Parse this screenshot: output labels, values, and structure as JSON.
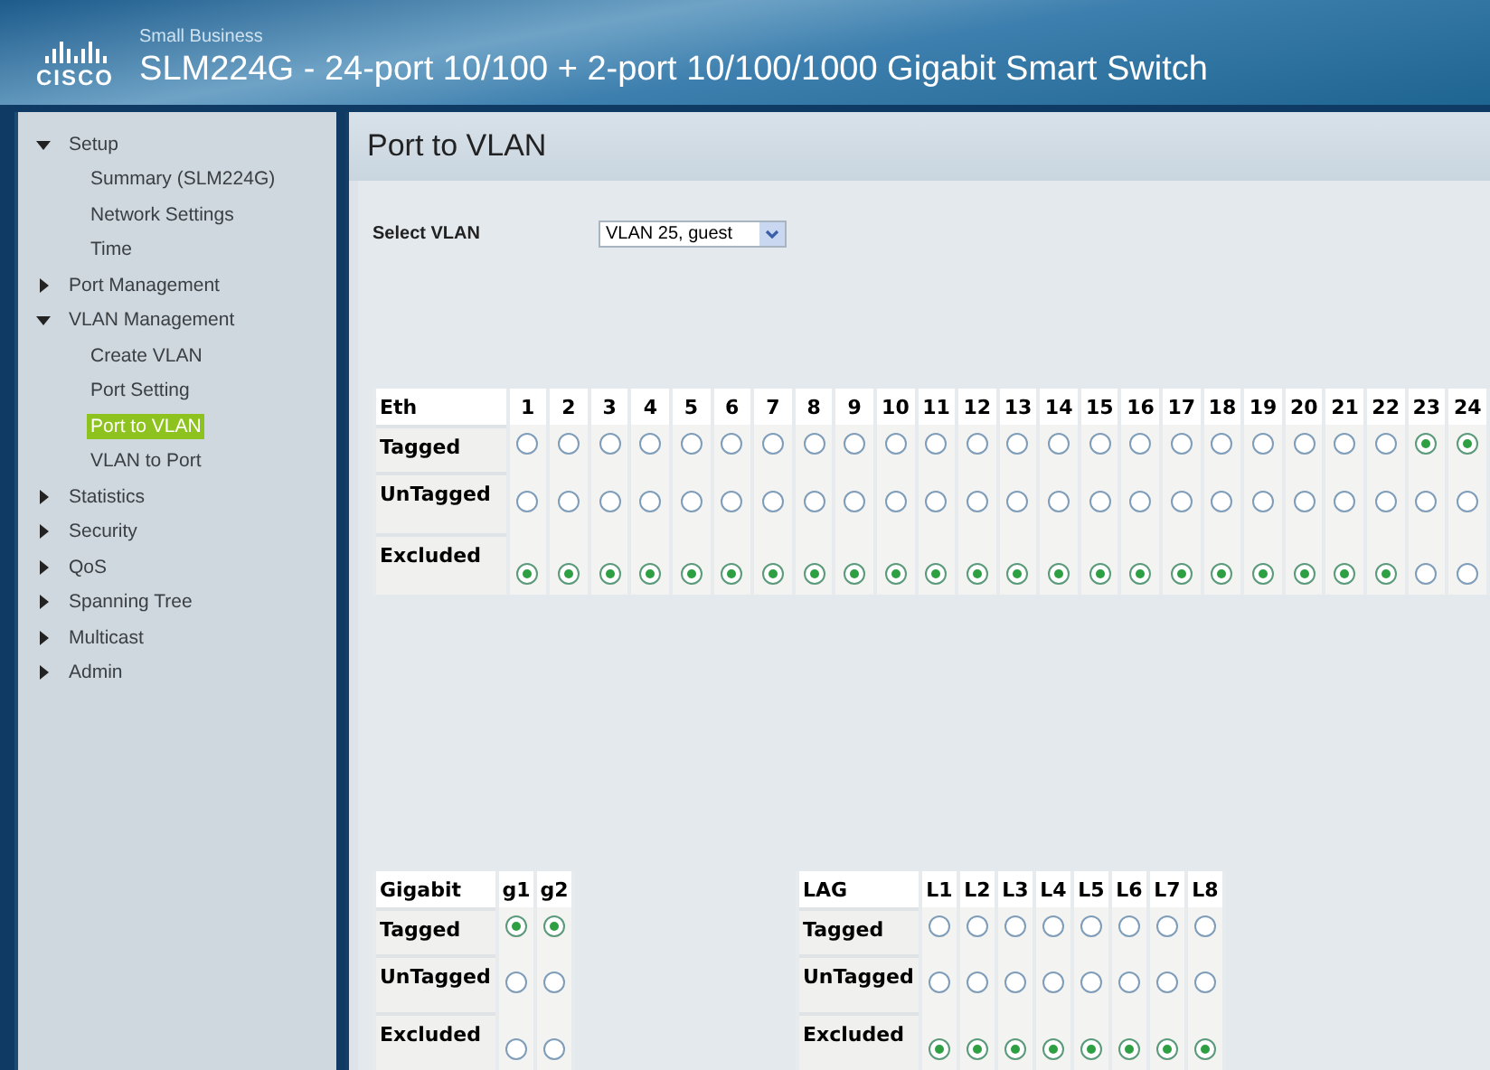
{
  "header": {
    "brand_tagline": "Small Business",
    "logo_text": "CISCO",
    "title": "SLM224G - 24-port 10/100 + 2-port 10/100/1000 Gigabit Smart Switch"
  },
  "sidebar": {
    "items": [
      {
        "label": "Setup",
        "expanded": true,
        "selected": false,
        "children": [
          {
            "label": "Summary (SLM224G)",
            "selected": false
          },
          {
            "label": "Network Settings",
            "selected": false
          },
          {
            "label": "Time",
            "selected": false
          }
        ]
      },
      {
        "label": "Port Management",
        "expanded": false,
        "selected": false
      },
      {
        "label": "VLAN Management",
        "expanded": true,
        "selected": false,
        "children": [
          {
            "label": "Create VLAN",
            "selected": false
          },
          {
            "label": "Port Setting",
            "selected": false
          },
          {
            "label": "Port to VLAN",
            "selected": true
          },
          {
            "label": "VLAN to Port",
            "selected": false
          }
        ]
      },
      {
        "label": "Statistics",
        "expanded": false,
        "selected": false
      },
      {
        "label": "Security",
        "expanded": false,
        "selected": false
      },
      {
        "label": "QoS",
        "expanded": false,
        "selected": false
      },
      {
        "label": "Spanning Tree",
        "expanded": false,
        "selected": false
      },
      {
        "label": "Multicast",
        "expanded": false,
        "selected": false
      },
      {
        "label": "Admin",
        "expanded": false,
        "selected": false
      }
    ]
  },
  "page_title": "Port to VLAN",
  "select_vlan": {
    "label": "Select VLAN",
    "value": "VLAN 25, guest"
  },
  "tables": [
    {
      "heading": "Eth",
      "columns": [
        "1",
        "2",
        "3",
        "4",
        "5",
        "6",
        "7",
        "8",
        "9",
        "10",
        "11",
        "12",
        "13",
        "14",
        "15",
        "16",
        "17",
        "18",
        "19",
        "20",
        "21",
        "22",
        "23",
        "24"
      ],
      "rows": [
        {
          "label": "Tagged",
          "cells": [
            {
              "selected": false
            },
            {
              "selected": false
            },
            {
              "selected": false
            },
            {
              "selected": false
            },
            {
              "selected": false
            },
            {
              "selected": false
            },
            {
              "selected": false
            },
            {
              "selected": false
            },
            {
              "selected": false
            },
            {
              "selected": false
            },
            {
              "selected": false
            },
            {
              "selected": false
            },
            {
              "selected": false
            },
            {
              "selected": false
            },
            {
              "selected": false
            },
            {
              "selected": false
            },
            {
              "selected": false
            },
            {
              "selected": false
            },
            {
              "selected": false
            },
            {
              "selected": false
            },
            {
              "selected": false
            },
            {
              "selected": false
            },
            {
              "selected": true
            },
            {
              "selected": true
            }
          ]
        },
        {
          "label": "UnTagged",
          "cells": [
            {
              "selected": false
            },
            {
              "selected": false
            },
            {
              "selected": false
            },
            {
              "selected": false
            },
            {
              "selected": false
            },
            {
              "selected": false
            },
            {
              "selected": false
            },
            {
              "selected": false
            },
            {
              "selected": false
            },
            {
              "selected": false
            },
            {
              "selected": false
            },
            {
              "selected": false
            },
            {
              "selected": false
            },
            {
              "selected": false
            },
            {
              "selected": false
            },
            {
              "selected": false
            },
            {
              "selected": false
            },
            {
              "selected": false
            },
            {
              "selected": false
            },
            {
              "selected": false
            },
            {
              "selected": false
            },
            {
              "selected": false
            },
            {
              "selected": false
            },
            {
              "selected": false
            }
          ]
        },
        {
          "label": "Excluded",
          "cells": [
            {
              "selected": true
            },
            {
              "selected": true
            },
            {
              "selected": true
            },
            {
              "selected": true
            },
            {
              "selected": true
            },
            {
              "selected": true
            },
            {
              "selected": true
            },
            {
              "selected": true
            },
            {
              "selected": true
            },
            {
              "selected": true
            },
            {
              "selected": true
            },
            {
              "selected": true
            },
            {
              "selected": true
            },
            {
              "selected": true
            },
            {
              "selected": true
            },
            {
              "selected": true
            },
            {
              "selected": true
            },
            {
              "selected": true
            },
            {
              "selected": true
            },
            {
              "selected": true
            },
            {
              "selected": true
            },
            {
              "selected": true
            },
            {
              "selected": false
            },
            {
              "selected": false
            }
          ]
        }
      ]
    },
    {
      "heading": "Gigabit",
      "columns": [
        "g1",
        "g2"
      ],
      "rows": [
        {
          "label": "Tagged",
          "cells": [
            {
              "selected": true
            },
            {
              "selected": true
            }
          ]
        },
        {
          "label": "UnTagged",
          "cells": [
            {
              "selected": false
            },
            {
              "selected": false
            }
          ]
        },
        {
          "label": "Excluded",
          "cells": [
            {
              "selected": false
            },
            {
              "selected": false
            }
          ]
        }
      ]
    },
    {
      "heading": "LAG",
      "columns": [
        "L1",
        "L2",
        "L3",
        "L4",
        "L5",
        "L6",
        "L7",
        "L8"
      ],
      "rows": [
        {
          "label": "Tagged",
          "cells": [
            {
              "selected": false
            },
            {
              "selected": false
            },
            {
              "selected": false
            },
            {
              "selected": false
            },
            {
              "selected": false
            },
            {
              "selected": false
            },
            {
              "selected": false
            },
            {
              "selected": false
            }
          ]
        },
        {
          "label": "UnTagged",
          "cells": [
            {
              "selected": false
            },
            {
              "selected": false
            },
            {
              "selected": false
            },
            {
              "selected": false
            },
            {
              "selected": false
            },
            {
              "selected": false
            },
            {
              "selected": false
            },
            {
              "selected": false
            }
          ]
        },
        {
          "label": "Excluded",
          "cells": [
            {
              "selected": true
            },
            {
              "selected": true
            },
            {
              "selected": true
            },
            {
              "selected": true
            },
            {
              "selected": true
            },
            {
              "selected": true
            },
            {
              "selected": true
            },
            {
              "selected": true
            }
          ]
        }
      ]
    }
  ]
}
